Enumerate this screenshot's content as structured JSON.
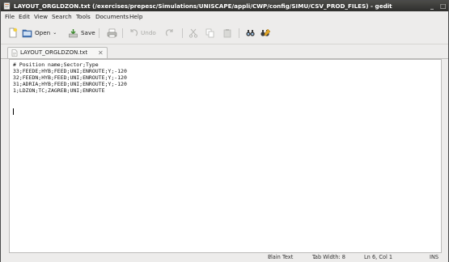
{
  "window": {
    "title": "LAYOUT_ORGLDZON.txt (/exercises/prepesc/Simulations/UNISCAPE/appli/CWP/config/SIMU/CSV_PROD_FILES) - gedit",
    "minimize_glyph": "_",
    "maximize_glyph": "□"
  },
  "menu": [
    "File",
    "Edit",
    "View",
    "Search",
    "Tools",
    "Documents",
    "Help"
  ],
  "toolbar": {
    "open_label": "Open",
    "save_label": "Save",
    "undo_label": "Undo"
  },
  "tab": {
    "label": "LAYOUT_ORGLDZON.txt",
    "close_glyph": "✕"
  },
  "editor": {
    "lines": [
      "# Position name;Sector;Type",
      "33;FEEDE;HYB;FEED;UNI;ENROUTE;Y;-120",
      "32;FEEDN;HYB;FEED;UNI;ENROUTE;Y;-120",
      "31;ADRIA;HYB;FEED;UNI;ENROUTE;Y;-120",
      "1;LDZON;TC;ZAGREB;UNI;ENROUTE",
      ""
    ]
  },
  "statusbar": {
    "language": "Plain Text",
    "tab_width": "Tab Width: 8",
    "position": "Ln 6, Col 1",
    "mode": "INS"
  },
  "icons": {
    "app": "gedit-icon",
    "new": "new-document-icon",
    "open": "open-folder-icon",
    "save": "save-icon",
    "print": "print-icon",
    "undo": "undo-icon",
    "redo": "redo-icon",
    "cut": "cut-icon",
    "copy": "copy-icon",
    "paste": "paste-icon",
    "find": "find-icon",
    "replace": "find-replace-icon"
  }
}
